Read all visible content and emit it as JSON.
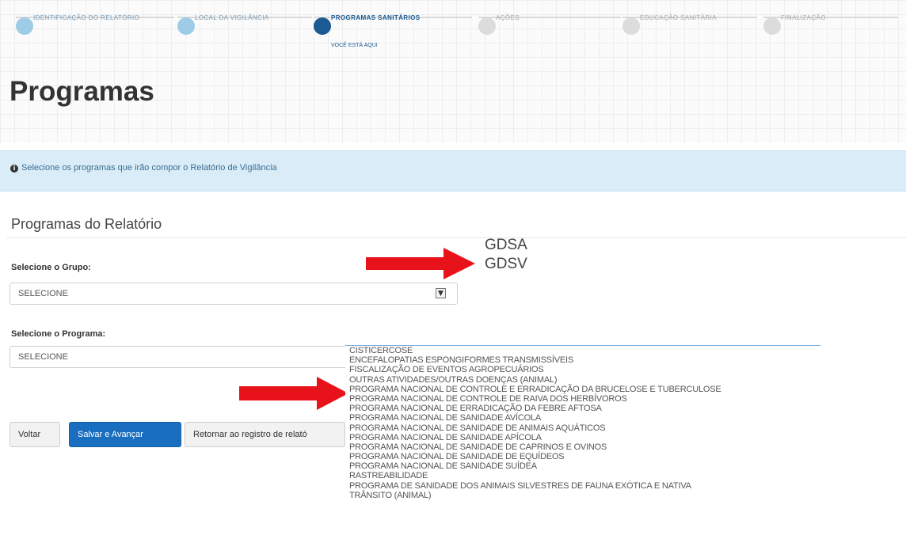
{
  "stepper": {
    "steps": [
      {
        "label": "IDENTIFICAÇÃO DO RELATÓRIO",
        "state": "done"
      },
      {
        "label": "LOCAL DA VIGILÂNCIA",
        "state": "done"
      },
      {
        "label": "PROGRAMAS SANITÁRIOS",
        "state": "current",
        "sub": "VOCÊ ESTÁ AQUI"
      },
      {
        "label": "AÇÕES",
        "state": "pending"
      },
      {
        "label": "EDUCAÇÃO SANITÁRIA",
        "state": "pending"
      },
      {
        "label": "FINALIZAÇÃO",
        "state": "pending"
      }
    ]
  },
  "page": {
    "title": "Programas"
  },
  "alert": {
    "icon": "info-icon",
    "text": "Selecione os programas que irão compor o Relatório de Vigilância"
  },
  "section": {
    "title": "Programas do Relatório"
  },
  "group_select": {
    "label": "Selecione o Grupo:",
    "value": "SELECIONE"
  },
  "program_select": {
    "label": "Selecione o Programa:",
    "value": "SELECIONE"
  },
  "buttons": {
    "back": "Voltar",
    "save_next": "Salvar e Avançar",
    "return_register": "Retornar ao registro de relató"
  },
  "group_options": [
    "GDSA",
    "GDSV"
  ],
  "program_options": [
    "CISTICERCOSE",
    "ENCEFALOPATIAS ESPONGIFORMES TRANSMISSÍVEIS",
    "FISCALIZAÇÃO DE EVENTOS AGROPECUÁRIOS",
    "OUTRAS ATIVIDADES/OUTRAS DOENÇAS (ANIMAL)",
    "PROGRAMA NACIONAL DE CONTROLE E ERRADICAÇÃO DA BRUCELOSE E TUBERCULOSE",
    "PROGRAMA NACIONAL DE CONTROLE DE RAIVA DOS HERBÍVOROS",
    "PROGRAMA NACIONAL DE ERRADICAÇÃO DA FEBRE AFTOSA",
    "PROGRAMA NACIONAL DE SANIDADE AVÍCOLA",
    "PROGRAMA NACIONAL DE SANIDADE DE ANIMAIS AQUÁTICOS",
    "PROGRAMA NACIONAL DE SANIDADE APÍCOLA",
    "PROGRAMA NACIONAL DE SANIDADE DE CAPRINOS E OVINOS",
    "PROGRAMA NACIONAL DE SANIDADE DE EQUÍDEOS",
    "PROGRAMA NACIONAL DE SANIDADE SUÍDEA",
    "RASTREABILIDADE",
    "PROGRAMA DE SANIDADE DOS ANIMAIS SILVESTRES DE FAUNA EXÓTICA E NATIVA",
    "TRÂNSITO (ANIMAL)"
  ],
  "colors": {
    "primary": "#1a6ec0",
    "current_step": "#1c5a93",
    "alert_bg": "#d9ecf7",
    "arrow": "#e8131a"
  }
}
